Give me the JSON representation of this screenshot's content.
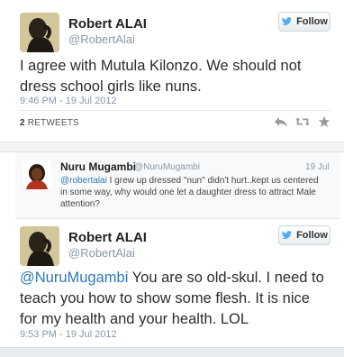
{
  "tweet1": {
    "name": "Robert ALAI",
    "handle": "@RobertAlai",
    "follow_label": "Follow",
    "text": "I agree with Mutula Kilonzo. We should not dress school girls like nuns.",
    "timestamp": "9:46 PM - 19 Jul 2012",
    "retweet_count": "2",
    "retweet_label": "RETWEETS"
  },
  "reply": {
    "name": "Nuru Mugambi",
    "handle": "@NuruMugambi",
    "date": "19 Jul",
    "mention": "@robertalai",
    "text": " I grew up dressed \"nun\" didn't hurt..kept us centered in some way, why would one let a daughter dress to attract Male attention?"
  },
  "tweet2": {
    "name": "Robert ALAI",
    "handle": "@RobertAlai",
    "follow_label": "Follow",
    "mention": "@NuruMugambi",
    "text": " You are so old-skul. I need to teach you how to show some flesh. It is nice for my health and your health. LOL",
    "timestamp": "9:53 PM - 19 Jul 2012"
  },
  "icons": {
    "follow": "twitter-bird-icon",
    "reply": "reply-icon",
    "retweet": "retweet-icon",
    "favorite": "star-icon"
  },
  "colors": {
    "link": "#2b7bb9",
    "meta": "#8899a6",
    "follow_bird": "#55acee"
  }
}
